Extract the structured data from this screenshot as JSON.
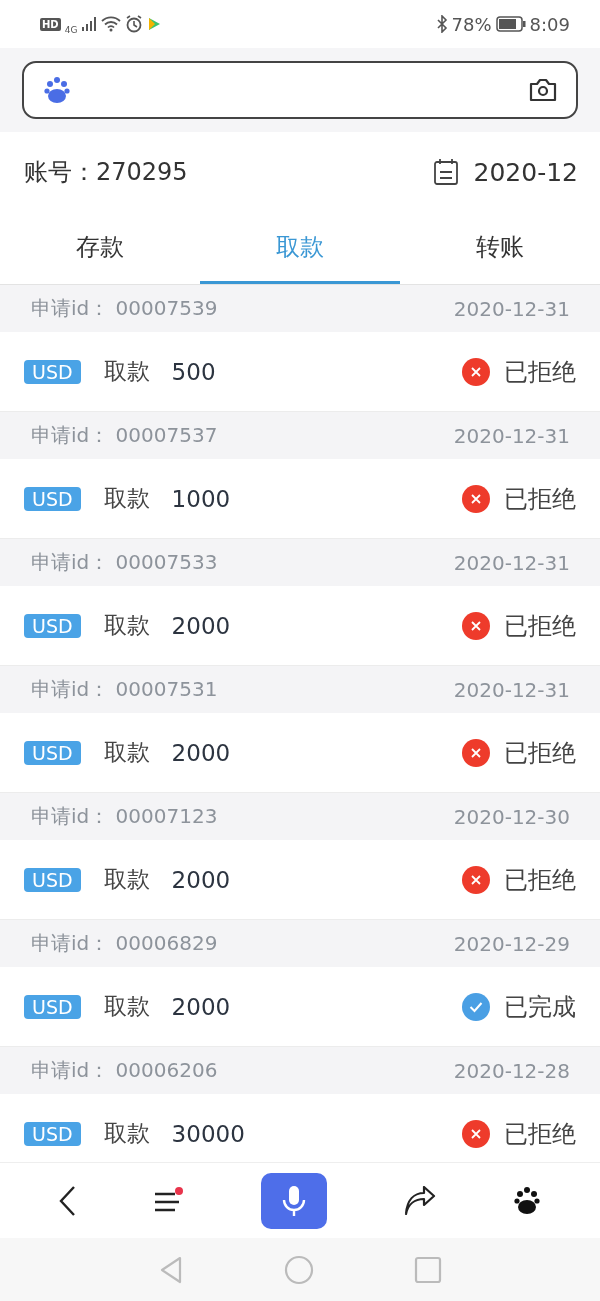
{
  "status_bar": {
    "hd_badge": "HD",
    "network_type": "4G",
    "battery_percent": "78%",
    "time": "8:09"
  },
  "account": {
    "label": "账号：",
    "number": "270295",
    "month": "2020-12"
  },
  "tabs": [
    {
      "label": "存款",
      "selected": false
    },
    {
      "label": "取款",
      "selected": true
    },
    {
      "label": "转账",
      "selected": false
    }
  ],
  "records": [
    {
      "id_label": "申请id：",
      "id": "00007539",
      "date": "2020-12-31",
      "currency": "USD",
      "type": "取款",
      "amount": "500",
      "status": "已拒绝",
      "kind": "rejected"
    },
    {
      "id_label": "申请id：",
      "id": "00007537",
      "date": "2020-12-31",
      "currency": "USD",
      "type": "取款",
      "amount": "1000",
      "status": "已拒绝",
      "kind": "rejected"
    },
    {
      "id_label": "申请id：",
      "id": "00007533",
      "date": "2020-12-31",
      "currency": "USD",
      "type": "取款",
      "amount": "2000",
      "status": "已拒绝",
      "kind": "rejected"
    },
    {
      "id_label": "申请id：",
      "id": "00007531",
      "date": "2020-12-31",
      "currency": "USD",
      "type": "取款",
      "amount": "2000",
      "status": "已拒绝",
      "kind": "rejected"
    },
    {
      "id_label": "申请id：",
      "id": "00007123",
      "date": "2020-12-30",
      "currency": "USD",
      "type": "取款",
      "amount": "2000",
      "status": "已拒绝",
      "kind": "rejected"
    },
    {
      "id_label": "申请id：",
      "id": "00006829",
      "date": "2020-12-29",
      "currency": "USD",
      "type": "取款",
      "amount": "2000",
      "status": "已完成",
      "kind": "completed"
    },
    {
      "id_label": "申请id：",
      "id": "00006206",
      "date": "2020-12-28",
      "currency": "USD",
      "type": "取款",
      "amount": "30000",
      "status": "已拒绝",
      "kind": "rejected"
    }
  ]
}
